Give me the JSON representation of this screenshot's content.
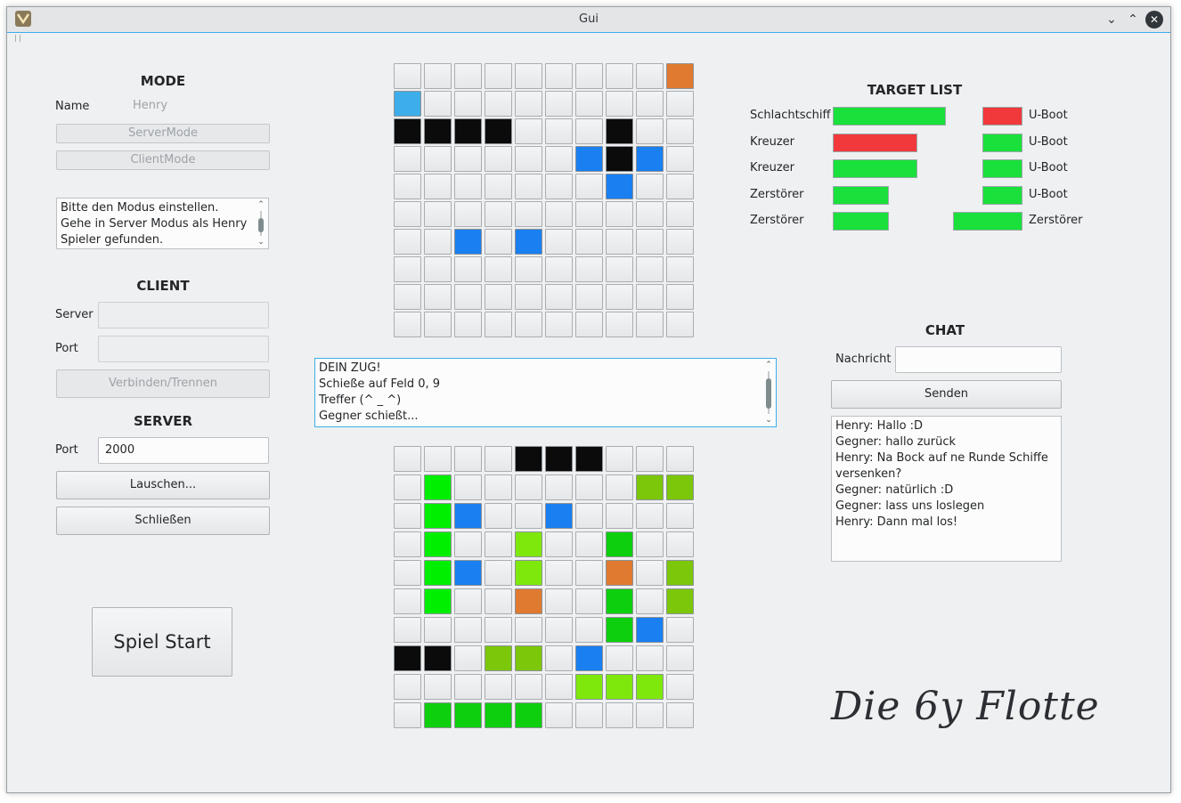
{
  "window": {
    "title": "Gui"
  },
  "mode": {
    "heading": "MODE",
    "name_label": "Name",
    "name_value": "Henry",
    "server_mode_button": "ServerMode",
    "client_mode_button": "ClientMode",
    "status_lines": [
      "Bitte den Modus einstellen.",
      "Gehe in Server Modus als Henry",
      "Spieler gefunden."
    ]
  },
  "client": {
    "heading": "CLIENT",
    "server_label": "Server",
    "server_value": "",
    "port_label": "Port",
    "port_value": "",
    "connect_button": "Verbinden/Trennen"
  },
  "server": {
    "heading": "SERVER",
    "port_label": "Port",
    "port_value": "2000",
    "listen_button": "Lauschen...",
    "close_button": "Schließen"
  },
  "start_button": "Spiel Start",
  "log": {
    "lines": [
      "DEIN ZUG!",
      "Schieße auf Feld 0, 9",
      "Treffer (^ _ ^)",
      "Gegner schießt..."
    ]
  },
  "colors": {
    "empty": "#e8e9ea",
    "black": "#0b0b0b",
    "blue": "#1a7ff0",
    "lightblue": "#3daee9",
    "orange": "#e07a30",
    "green": "#00ef00",
    "lime": "#7ee80d",
    "darkgreen": "#0ecf0e",
    "olive": "#7cc70a",
    "bar_green": "#19e03a",
    "bar_red": "#f1383b"
  },
  "enemy_board": [
    [
      "e",
      "e",
      "e",
      "e",
      "e",
      "e",
      "e",
      "e",
      "e",
      "O"
    ],
    [
      "L",
      "e",
      "e",
      "e",
      "e",
      "e",
      "e",
      "e",
      "e",
      "e"
    ],
    [
      "K",
      "K",
      "K",
      "K",
      "e",
      "e",
      "e",
      "K",
      "e",
      "e"
    ],
    [
      "e",
      "e",
      "e",
      "e",
      "e",
      "e",
      "B",
      "K",
      "B",
      "e"
    ],
    [
      "e",
      "e",
      "e",
      "e",
      "e",
      "e",
      "e",
      "B",
      "e",
      "e"
    ],
    [
      "e",
      "e",
      "e",
      "e",
      "e",
      "e",
      "e",
      "e",
      "e",
      "e"
    ],
    [
      "e",
      "e",
      "B",
      "e",
      "B",
      "e",
      "e",
      "e",
      "e",
      "e"
    ],
    [
      "e",
      "e",
      "e",
      "e",
      "e",
      "e",
      "e",
      "e",
      "e",
      "e"
    ],
    [
      "e",
      "e",
      "e",
      "e",
      "e",
      "e",
      "e",
      "e",
      "e",
      "e"
    ],
    [
      "e",
      "e",
      "e",
      "e",
      "e",
      "e",
      "e",
      "e",
      "e",
      "e"
    ]
  ],
  "own_board": [
    [
      "e",
      "e",
      "e",
      "e",
      "K",
      "K",
      "K",
      "e",
      "e",
      "e"
    ],
    [
      "e",
      "G",
      "e",
      "e",
      "e",
      "e",
      "e",
      "e",
      "V",
      "V"
    ],
    [
      "e",
      "G",
      "B",
      "e",
      "e",
      "B",
      "e",
      "e",
      "e",
      "e"
    ],
    [
      "e",
      "G",
      "e",
      "e",
      "M",
      "e",
      "e",
      "D",
      "e",
      "e"
    ],
    [
      "e",
      "G",
      "B",
      "e",
      "M",
      "e",
      "e",
      "O",
      "e",
      "V"
    ],
    [
      "e",
      "G",
      "e",
      "e",
      "O",
      "e",
      "e",
      "D",
      "e",
      "V"
    ],
    [
      "e",
      "e",
      "e",
      "e",
      "e",
      "e",
      "e",
      "D",
      "B",
      "e"
    ],
    [
      "K",
      "K",
      "e",
      "V",
      "V",
      "e",
      "B",
      "e",
      "e",
      "e"
    ],
    [
      "e",
      "e",
      "e",
      "e",
      "e",
      "e",
      "M",
      "M",
      "M",
      "e"
    ],
    [
      "e",
      "D",
      "D",
      "D",
      "D",
      "e",
      "e",
      "e",
      "e",
      "e"
    ]
  ],
  "target_list": {
    "heading": "TARGET LIST",
    "left": [
      {
        "name": "Schlachtschiff",
        "status": "ok",
        "size": 4
      },
      {
        "name": "Kreuzer",
        "status": "sunk",
        "size": 3
      },
      {
        "name": "Kreuzer",
        "status": "ok",
        "size": 3
      },
      {
        "name": "Zerstörer",
        "status": "ok",
        "size": 2
      },
      {
        "name": "Zerstörer",
        "status": "ok",
        "size": 2
      }
    ],
    "right": [
      {
        "name": "U-Boot",
        "status": "sunk",
        "size": 1.5
      },
      {
        "name": "U-Boot",
        "status": "ok",
        "size": 1.5
      },
      {
        "name": "U-Boot",
        "status": "ok",
        "size": 1.5
      },
      {
        "name": "U-Boot",
        "status": "ok",
        "size": 1.5
      },
      {
        "name": "Zerstörer",
        "status": "ok",
        "size": 2.6
      }
    ]
  },
  "chat": {
    "heading": "CHAT",
    "message_label": "Nachricht",
    "message_value": "",
    "send_button": "Senden",
    "lines": [
      "Henry: Hallo :D",
      "Gegner: hallo zurück",
      "Henry: Na Bock auf ne Runde Schiffe",
      "versenken?",
      "Gegner: natürlich :D",
      "Gegner: lass uns loslegen",
      "Henry: Dann mal los!"
    ]
  },
  "logo_text": "Die 6y Flotte"
}
